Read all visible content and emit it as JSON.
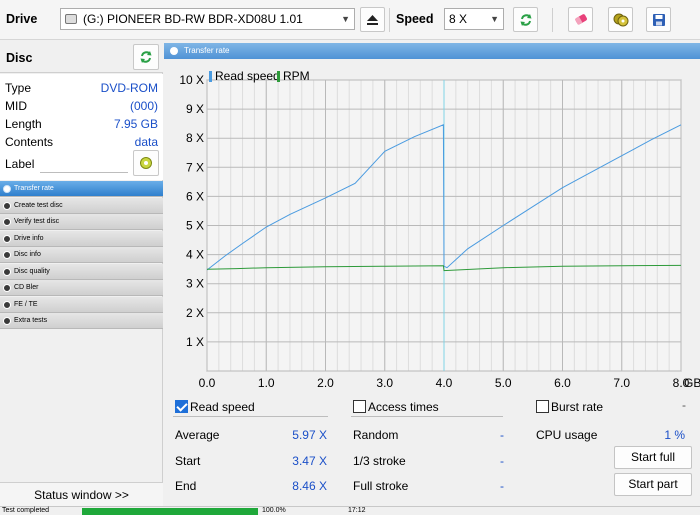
{
  "toolbar": {
    "drive_label": "Drive",
    "drive_value": "(G:)   PIONEER BD-RW   BDR-XD08U 1.01",
    "speed_label": "Speed",
    "speed_value": "8 X"
  },
  "disc": {
    "title": "Disc",
    "type_key": "Type",
    "type_val": "DVD-ROM",
    "mid_key": "MID",
    "mid_val": "(000)",
    "length_key": "Length",
    "length_val": "7.95 GB",
    "contents_key": "Contents",
    "contents_val": "data",
    "label_key": "Label",
    "label_val": ""
  },
  "nav": [
    {
      "label": "Transfer rate",
      "active": true
    },
    {
      "label": "Create test disc"
    },
    {
      "label": "Verify test disc"
    },
    {
      "label": "Drive info"
    },
    {
      "label": "Disc info"
    },
    {
      "label": "Disc quality"
    },
    {
      "label": "CD Bler"
    },
    {
      "label": "FE / TE"
    },
    {
      "label": "Extra tests"
    }
  ],
  "status_window_label": "Status window >>",
  "panel_title": "Transfer rate",
  "colors": {
    "read_speed": "#4a9be0",
    "rpm": "#2e9a3a",
    "accent": "#1a4fc8",
    "progress": "#1fa83a"
  },
  "chart_data": {
    "type": "line",
    "xlabel": "GB",
    "xlim": [
      0,
      8.0
    ],
    "ylim": [
      0,
      10
    ],
    "x_ticks": [
      "0.0",
      "1.0",
      "2.0",
      "3.0",
      "4.0",
      "5.0",
      "6.0",
      "7.0",
      "8.0"
    ],
    "y_ticks": [
      "1 X",
      "2 X",
      "3 X",
      "4 X",
      "5 X",
      "6 X",
      "7 X",
      "8 X",
      "9 X",
      "10 X"
    ],
    "grid": true,
    "legend": [
      "Read speed",
      "RPM"
    ],
    "series": [
      {
        "name": "Read speed",
        "x": [
          0,
          0.3,
          0.6,
          1.0,
          1.4,
          2.0,
          2.5,
          3.0,
          3.5,
          3.99,
          4.0,
          4.05,
          4.4,
          5.0,
          5.5,
          6.0,
          6.5,
          7.0,
          7.5,
          8.0
        ],
        "y": [
          3.47,
          3.95,
          4.38,
          4.95,
          5.38,
          5.95,
          6.45,
          7.55,
          8.05,
          8.46,
          3.6,
          3.55,
          4.2,
          5.0,
          5.65,
          6.3,
          6.85,
          7.4,
          7.95,
          8.46
        ]
      },
      {
        "name": "RPM",
        "x": [
          0,
          0.5,
          1.0,
          2.0,
          3.0,
          3.99,
          4.0,
          5.0,
          6.0,
          7.0,
          8.0
        ],
        "y": [
          3.5,
          3.52,
          3.55,
          3.58,
          3.6,
          3.62,
          3.45,
          3.55,
          3.6,
          3.62,
          3.63
        ]
      }
    ]
  },
  "stats": {
    "read_speed_label": "Read speed",
    "access_times_label": "Access times",
    "burst_rate_label": "Burst rate",
    "burst_rate_val": "-",
    "average_label": "Average",
    "average_val": "5.97 X",
    "start_label": "Start",
    "start_val": "3.47 X",
    "end_label": "End",
    "end_val": "8.46 X",
    "random_label": "Random",
    "random_val": "-",
    "third_label": "1/3 stroke",
    "third_val": "-",
    "full_label": "Full stroke",
    "full_val": "-",
    "cpu_label": "CPU usage",
    "cpu_val": "1 %",
    "start_full_label": "Start full",
    "start_part_label": "Start part"
  },
  "statusbar": {
    "message": "Test completed",
    "progress_text": "100.0%",
    "progress_fraction": 1.0,
    "time": "17:12"
  }
}
